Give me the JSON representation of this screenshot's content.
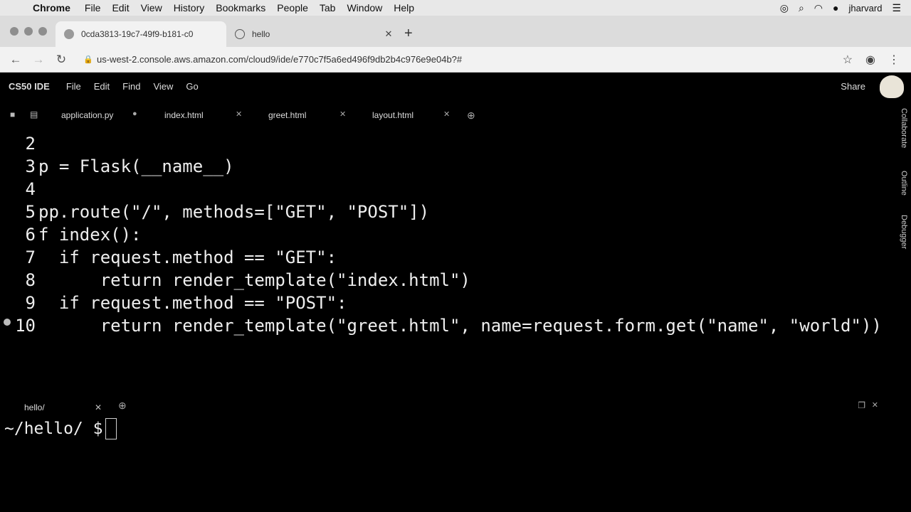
{
  "menubar": {
    "app": "Chrome",
    "items": [
      "File",
      "Edit",
      "View",
      "History",
      "Bookmarks",
      "People",
      "Tab",
      "Window",
      "Help"
    ],
    "user": "jharvard"
  },
  "browser": {
    "tabs": [
      {
        "title": "0cda3813-19c7-49f9-b181-c0"
      },
      {
        "title": "hello"
      }
    ],
    "url": "us-west-2.console.aws.amazon.com/cloud9/ide/e770c7f5a6ed496f9db2b4c976e9e04b?#"
  },
  "ide": {
    "brand": "CS50 IDE",
    "menu": [
      "File",
      "Edit",
      "Find",
      "View",
      "Go"
    ],
    "share": "Share",
    "editor_tabs": [
      "application.py",
      "index.html",
      "greet.html",
      "layout.html"
    ],
    "side_panels": [
      "Collaborate",
      "Outline",
      "Debugger"
    ],
    "code_lines": [
      {
        "n": "2",
        "text": ""
      },
      {
        "n": "3",
        "text": "p = Flask(__name__)"
      },
      {
        "n": "4",
        "text": ""
      },
      {
        "n": "5",
        "text": "pp.route(\"/\", methods=[\"GET\", \"POST\"])"
      },
      {
        "n": "6",
        "text": "f index():"
      },
      {
        "n": "7",
        "text": "  if request.method == \"GET\":"
      },
      {
        "n": "8",
        "text": "      return render_template(\"index.html\")"
      },
      {
        "n": "9",
        "text": "  if request.method == \"POST\":"
      },
      {
        "n": "10",
        "text": "      return render_template(\"greet.html\", name=request.form.get(\"name\", \"world\"))"
      }
    ],
    "terminal_tab": "hello/",
    "terminal_prompt": "~/hello/ $"
  }
}
